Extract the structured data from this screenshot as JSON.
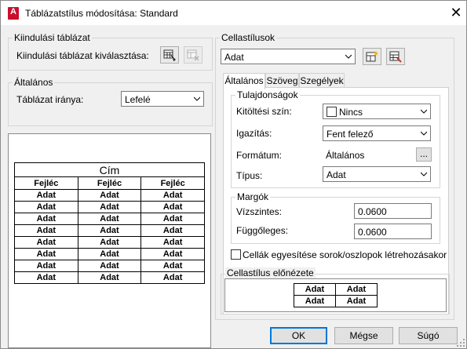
{
  "window": {
    "title": "Táblázatstílus módosítása: Standard",
    "app_icon": "A"
  },
  "start_table": {
    "group_label": "Kiindulási táblázat",
    "select_label": "Kiindulási táblázat kiválasztása:"
  },
  "general": {
    "group_label": "Általános",
    "direction_label": "Táblázat iránya:",
    "direction_value": "Lefelé"
  },
  "preview_table": {
    "title": "Cím",
    "headers": [
      "Fejléc",
      "Fejléc",
      "Fejléc"
    ],
    "rows": [
      [
        "Adat",
        "Adat",
        "Adat"
      ],
      [
        "Adat",
        "Adat",
        "Adat"
      ],
      [
        "Adat",
        "Adat",
        "Adat"
      ],
      [
        "Adat",
        "Adat",
        "Adat"
      ],
      [
        "Adat",
        "Adat",
        "Adat"
      ],
      [
        "Adat",
        "Adat",
        "Adat"
      ],
      [
        "Adat",
        "Adat",
        "Adat"
      ],
      [
        "Adat",
        "Adat",
        "Adat"
      ]
    ]
  },
  "cell_styles": {
    "group_label": "Cellastílusok",
    "style_value": "Adat",
    "tabs": [
      "Általános",
      "Szöveg",
      "Szegélyek"
    ],
    "properties": {
      "group_label": "Tulajdonságok",
      "fill_label": "Kitöltési szín:",
      "fill_value": "Nincs",
      "align_label": "Igazítás:",
      "align_value": "Fent felező",
      "format_label": "Formátum:",
      "format_value": "Általános",
      "format_button": "...",
      "type_label": "Típus:",
      "type_value": "Adat"
    },
    "margins": {
      "group_label": "Margók",
      "horizontal_label": "Vízszintes:",
      "horizontal_value": "0.0600",
      "vertical_label": "Függőleges:",
      "vertical_value": "0.0600"
    },
    "merge_checkbox_label": "Cellák egyesítése sorok/oszlopok létrehozásakor",
    "merge_checked": false
  },
  "cell_preview": {
    "group_label": "Cellastílus előnézete",
    "rows": [
      [
        "Adat",
        "Adat"
      ],
      [
        "Adat",
        "Adat"
      ]
    ]
  },
  "buttons": {
    "ok": "OK",
    "cancel": "Mégse",
    "help": "Súgó"
  },
  "colors": {
    "app_icon": "#c8102e",
    "default_button_border": "#0078d7"
  }
}
